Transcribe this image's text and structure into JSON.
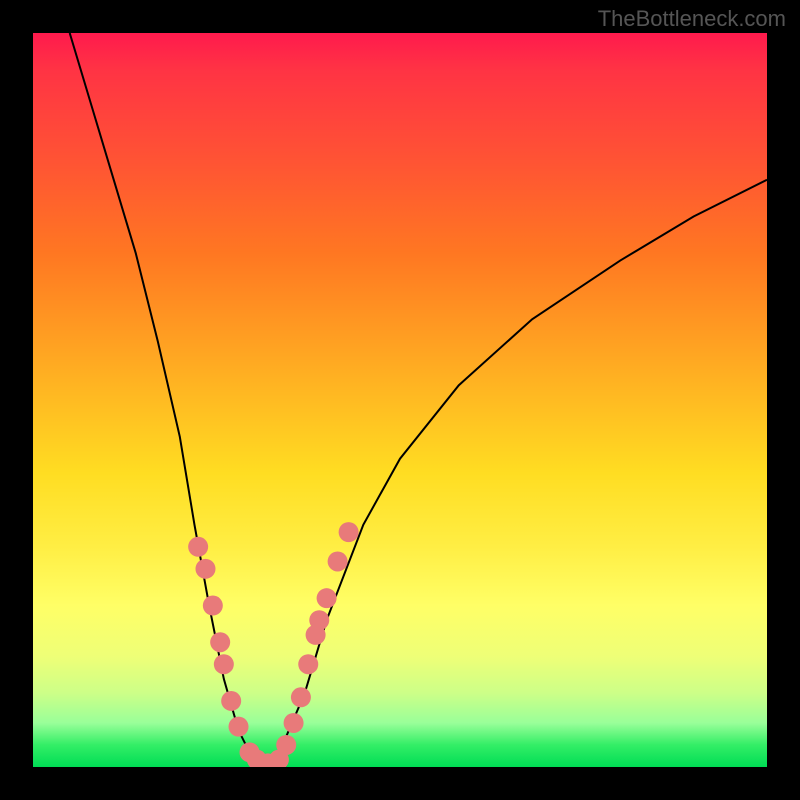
{
  "watermark": "TheBottleneck.com",
  "chart_data": {
    "type": "line",
    "title": "",
    "xlabel": "",
    "ylabel": "",
    "xlim": [
      0,
      100
    ],
    "ylim": [
      0,
      100
    ],
    "curve_left": [
      {
        "x": 5,
        "y": 100
      },
      {
        "x": 8,
        "y": 90
      },
      {
        "x": 11,
        "y": 80
      },
      {
        "x": 14,
        "y": 70
      },
      {
        "x": 17,
        "y": 58
      },
      {
        "x": 20,
        "y": 45
      },
      {
        "x": 22,
        "y": 33
      },
      {
        "x": 24,
        "y": 22
      },
      {
        "x": 26,
        "y": 12
      },
      {
        "x": 28,
        "y": 5
      },
      {
        "x": 30,
        "y": 1
      },
      {
        "x": 32,
        "y": 0
      }
    ],
    "curve_right": [
      {
        "x": 32,
        "y": 0
      },
      {
        "x": 34,
        "y": 3
      },
      {
        "x": 37,
        "y": 10
      },
      {
        "x": 40,
        "y": 20
      },
      {
        "x": 45,
        "y": 33
      },
      {
        "x": 50,
        "y": 42
      },
      {
        "x": 58,
        "y": 52
      },
      {
        "x": 68,
        "y": 61
      },
      {
        "x": 80,
        "y": 69
      },
      {
        "x": 90,
        "y": 75
      },
      {
        "x": 100,
        "y": 80
      }
    ],
    "markers_left": [
      {
        "x": 22.5,
        "y": 30
      },
      {
        "x": 23.5,
        "y": 27
      },
      {
        "x": 24.5,
        "y": 22
      },
      {
        "x": 25.5,
        "y": 17
      },
      {
        "x": 26.0,
        "y": 14
      },
      {
        "x": 27.0,
        "y": 9
      },
      {
        "x": 28.0,
        "y": 5.5
      },
      {
        "x": 29.5,
        "y": 2
      },
      {
        "x": 30.5,
        "y": 1
      },
      {
        "x": 32.0,
        "y": 0.5
      }
    ],
    "markers_right": [
      {
        "x": 33.5,
        "y": 1
      },
      {
        "x": 34.5,
        "y": 3
      },
      {
        "x": 35.5,
        "y": 6
      },
      {
        "x": 36.5,
        "y": 9.5
      },
      {
        "x": 37.5,
        "y": 14
      },
      {
        "x": 38.5,
        "y": 18
      },
      {
        "x": 39.0,
        "y": 20
      },
      {
        "x": 40.0,
        "y": 23
      },
      {
        "x": 41.5,
        "y": 28
      },
      {
        "x": 43.0,
        "y": 32
      }
    ],
    "marker_color": "#e87a7a",
    "curve_color": "#000000"
  }
}
